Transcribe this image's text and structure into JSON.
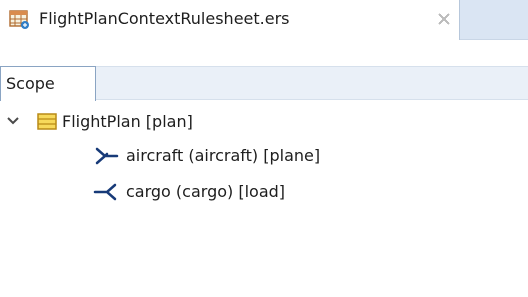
{
  "editor_tab": {
    "title": "FlightPlanContextRulesheet.ers",
    "icon": "rulesheet-icon",
    "close_icon": "close-icon"
  },
  "panel": {
    "tab_label": "Scope"
  },
  "tree": {
    "root": {
      "label": "FlightPlan [plan]",
      "expanded": true,
      "icon": "entity-icon"
    },
    "children": [
      {
        "label": "aircraft (aircraft) [plane]",
        "icon": "outgoing-association-icon"
      },
      {
        "label": "cargo (cargo) [load]",
        "icon": "incoming-association-icon"
      }
    ]
  },
  "colors": {
    "tab_strip": "#dae5f3",
    "panel_header": "#eaf0f8",
    "entity_icon_fill": "#f7d95b",
    "association_icon": "#173a78"
  }
}
